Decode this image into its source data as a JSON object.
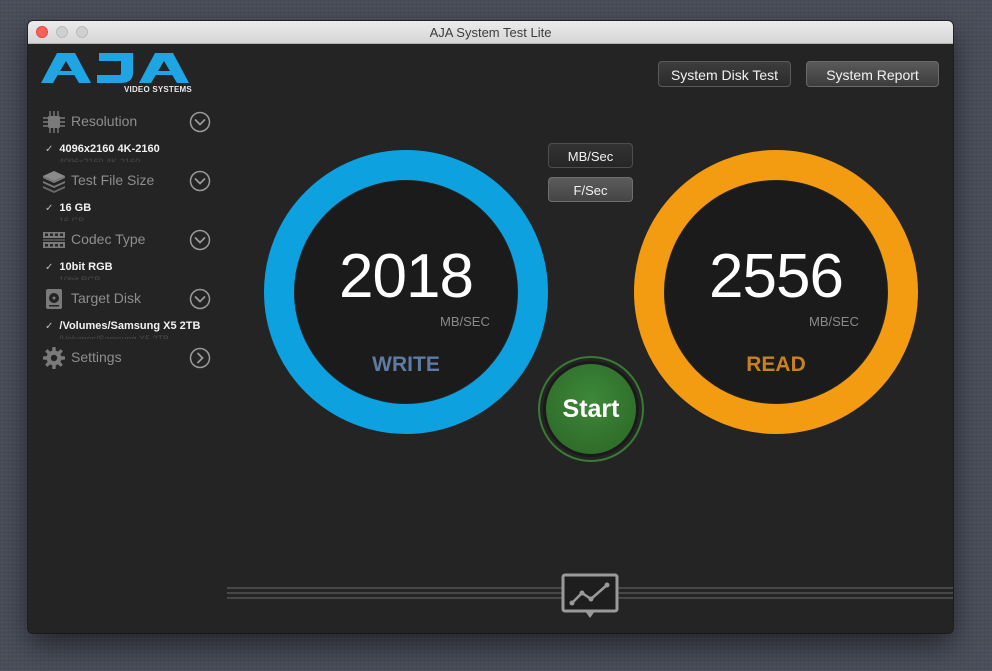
{
  "window": {
    "title": "AJA System Test Lite"
  },
  "logo": {
    "text": "AJA",
    "subtitle": "VIDEO SYSTEMS",
    "color": "#1fa5e3"
  },
  "sidebar": {
    "items": [
      {
        "label": "Resolution",
        "icon": "chip-icon",
        "value": "4096x2160 4K-2160",
        "ghost": "4096x2160 4K-2160",
        "expander": "chevron-down-icon"
      },
      {
        "label": "Test File Size",
        "icon": "stack-icon",
        "value": "16 GB",
        "ghost": "16 GB",
        "expander": "chevron-down-icon"
      },
      {
        "label": "Codec Type",
        "icon": "film-strip-icon",
        "value": "10bit RGB",
        "ghost": "10bit RGB",
        "expander": "chevron-down-icon"
      },
      {
        "label": "Target Disk",
        "icon": "disk-icon",
        "value": "/Volumes/Samsung X5 2TB",
        "ghost": "/Volumes/Samsung X5 2TB",
        "expander": "chevron-down-icon"
      },
      {
        "label": "Settings",
        "icon": "gear-icon",
        "expander": "chevron-right-icon"
      }
    ],
    "check_glyph": "✓"
  },
  "toolbar": {
    "disk_test_label": "System Disk Test",
    "report_label": "System Report"
  },
  "units": {
    "mb_label": "MB/Sec",
    "fs_label": "F/Sec",
    "selected": "F/Sec"
  },
  "write": {
    "value": "2018",
    "unit": "MB/SEC",
    "label": "WRITE",
    "ring_color": "#0ea1e0",
    "label_color": "#5f7aa3"
  },
  "read": {
    "value": "2556",
    "unit": "MB/SEC",
    "label": "READ",
    "ring_color": "#f39c12",
    "label_color": "#c8821c"
  },
  "start": {
    "label": "Start",
    "color": "#2f6e2b"
  },
  "graph": {
    "icon": "graph-icon"
  }
}
